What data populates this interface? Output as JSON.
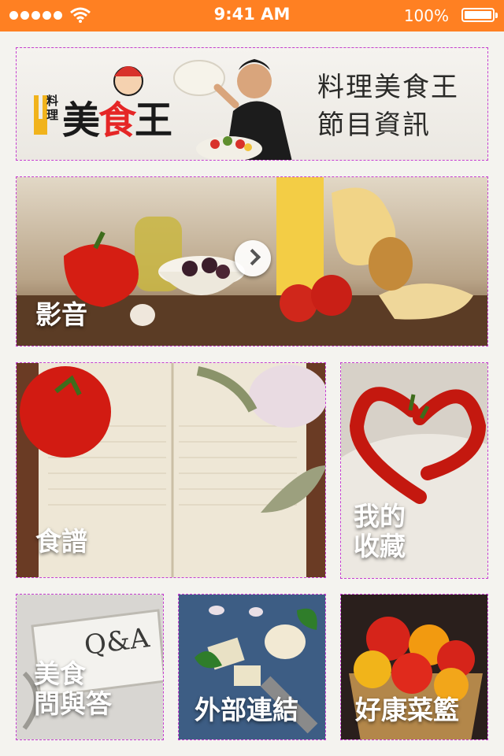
{
  "status_bar": {
    "time": "9:41 AM",
    "battery": "100%",
    "signal_icon": "signal-dots-icon",
    "wifi_icon": "wifi-icon",
    "battery_icon": "battery-icon",
    "background_color": "#ff8022"
  },
  "header": {
    "logo_small": "料理",
    "logo_main_1": "美",
    "logo_main_2": "食",
    "logo_main_3": "王",
    "title_line1": "料理美食王",
    "title_line2": "節目資訊",
    "title_color": "#2a2a28"
  },
  "tiles": {
    "video": {
      "label": "影音",
      "icon": "chevron-right-icon"
    },
    "recipes": {
      "label": "食譜"
    },
    "favorites": {
      "label_line1": "我的",
      "label_line2": "收藏"
    },
    "qa": {
      "label_line1": "美食",
      "label_line2": "問與答",
      "sign_text": "Q&A"
    },
    "links": {
      "label": "外部連結"
    },
    "basket": {
      "label": "好康菜籃"
    }
  }
}
